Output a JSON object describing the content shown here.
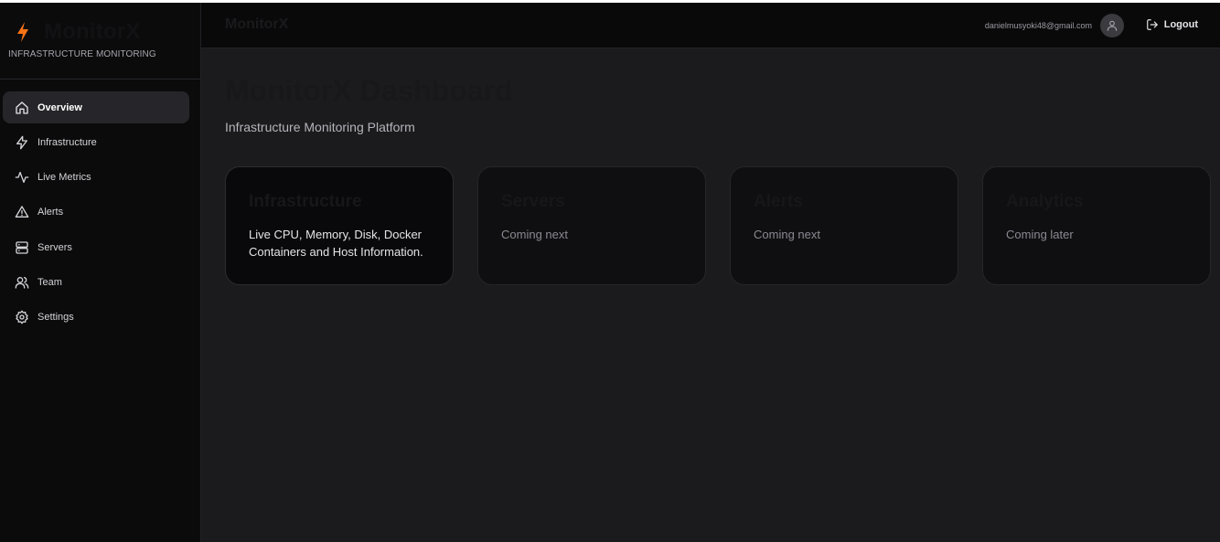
{
  "brand": {
    "name": "MonitorX",
    "subtitle": "INFRASTRUCTURE MONITORING",
    "icon": "lightning-bolt-icon",
    "accent_color": "#f97316"
  },
  "sidebar": {
    "items": [
      {
        "label": "Overview",
        "icon": "home-icon",
        "active": true
      },
      {
        "label": "Infrastructure",
        "icon": "lightning-icon"
      },
      {
        "label": "Live Metrics",
        "icon": "activity-icon"
      },
      {
        "label": "Alerts",
        "icon": "alert-triangle-icon"
      },
      {
        "label": "Servers",
        "icon": "server-icon"
      },
      {
        "label": "Team",
        "icon": "users-icon"
      },
      {
        "label": "Settings",
        "icon": "gear-icon"
      }
    ]
  },
  "topbar": {
    "title": "MonitorX",
    "user_email": "danielmusyoki48@gmail.com",
    "logout_label": "Logout"
  },
  "page": {
    "title": "MonitorX Dashboard",
    "subtitle": "Infrastructure Monitoring Platform"
  },
  "cards": [
    {
      "title": "Infrastructure",
      "description": "Live CPU, Memory, Disk, Docker Containers and Host Information."
    },
    {
      "title": "Servers",
      "description": "Coming next"
    },
    {
      "title": "Alerts",
      "description": "Coming next"
    },
    {
      "title": "Analytics",
      "description": "Coming later"
    }
  ]
}
